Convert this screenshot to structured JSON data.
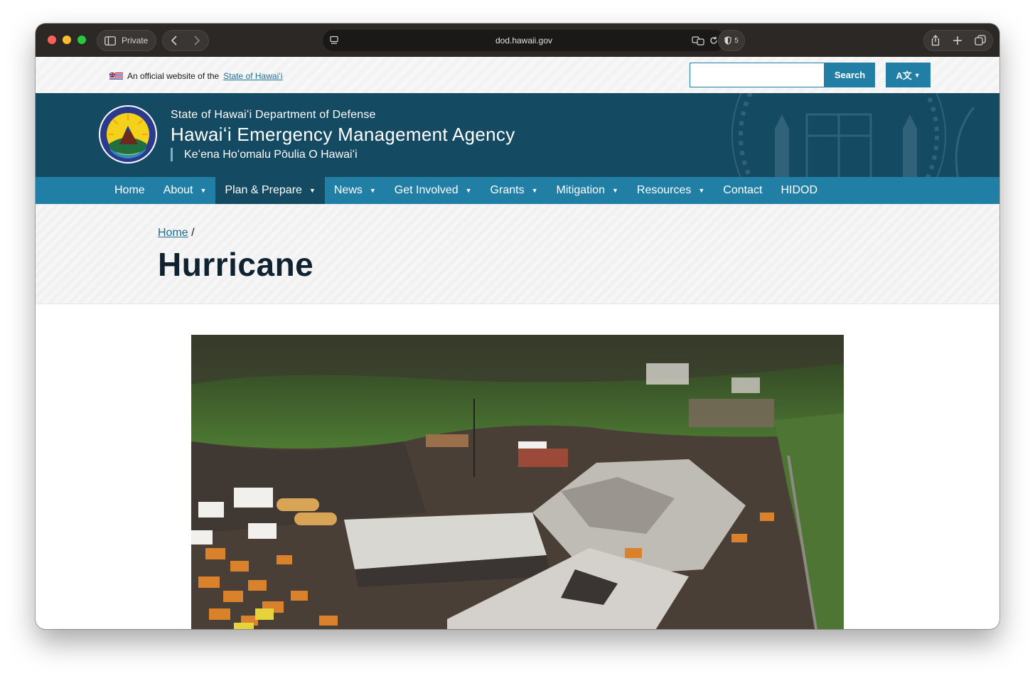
{
  "browser": {
    "private_label": "Private",
    "url": "dod.hawaii.gov",
    "tracker_count": "5"
  },
  "official_bar": {
    "text": "An official website of the",
    "link": "State of Hawaiʻi",
    "search_button": "Search",
    "language_button": "A文"
  },
  "banner": {
    "department": "State of Hawaiʻi Department of Defense",
    "agency": "Hawaiʻi Emergency Management Agency",
    "hawaiian": "Keʻena Hoʻomalu Pōulia O Hawaiʻi"
  },
  "nav": {
    "items": [
      {
        "label": "Home"
      },
      {
        "label": "About"
      },
      {
        "label": "Plan & Prepare"
      },
      {
        "label": "News"
      },
      {
        "label": "Get Involved"
      },
      {
        "label": "Grants"
      },
      {
        "label": "Mitigation"
      },
      {
        "label": "Resources"
      },
      {
        "label": "Contact"
      },
      {
        "label": "HIDOD"
      }
    ]
  },
  "breadcrumb": {
    "home": "Home",
    "separator": "/"
  },
  "page": {
    "title": "Hurricane"
  },
  "colors": {
    "chrome": "#2b2826",
    "banner": "#154a63",
    "nav": "#217fa6",
    "nav_active": "#154a63",
    "link": "#1e6f96",
    "title": "#0e2230"
  }
}
